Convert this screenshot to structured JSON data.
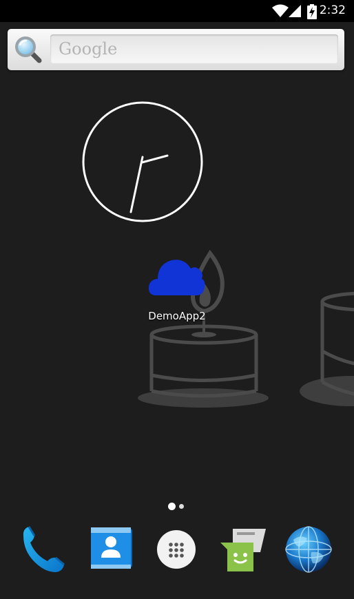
{
  "status_bar": {
    "time": "2:32",
    "icons": [
      "wifi-icon",
      "cell-signal-icon",
      "battery-charging-icon"
    ]
  },
  "search_widget": {
    "placeholder": "Google",
    "icon": "search-icon"
  },
  "clock_widget": {
    "type": "analog-clock",
    "hour": 2,
    "minute": 32
  },
  "home_screen": {
    "shortcut": {
      "label": "DemoApp2",
      "icon": "cloud-icon",
      "color": "#1034d6"
    },
    "wallpaper": "candles"
  },
  "page_indicator": {
    "pages": 2,
    "current": 1
  },
  "dock": {
    "items": [
      {
        "name": "phone",
        "icon": "phone-icon"
      },
      {
        "name": "contacts",
        "icon": "contacts-icon"
      },
      {
        "name": "all-apps",
        "icon": "app-drawer-icon"
      },
      {
        "name": "messaging",
        "icon": "messaging-icon"
      },
      {
        "name": "browser",
        "icon": "globe-icon"
      }
    ]
  }
}
